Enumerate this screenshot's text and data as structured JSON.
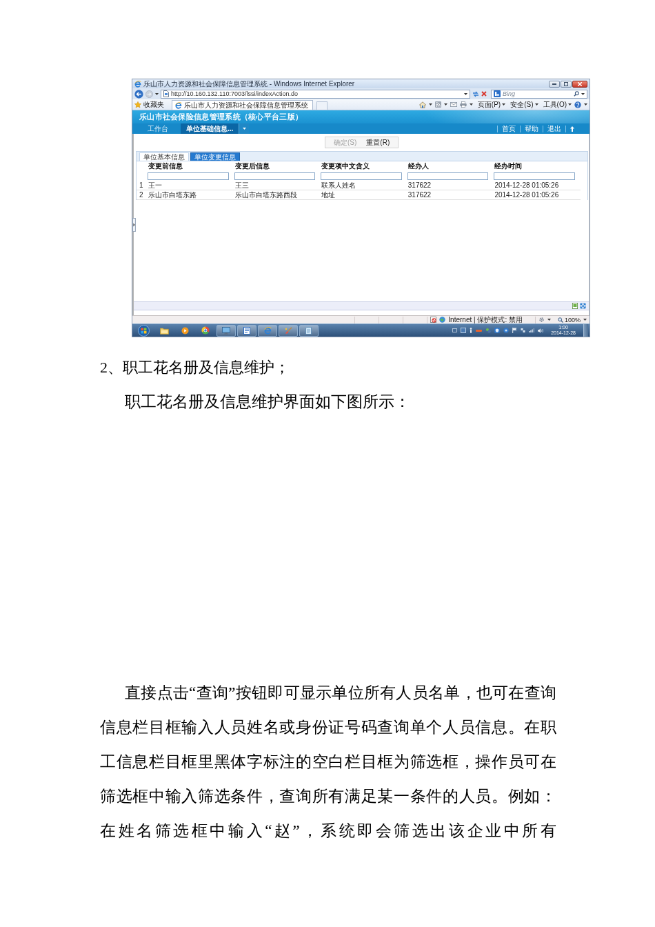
{
  "screenshot": {
    "window": {
      "title": "乐山市人力资源和社会保障信息管理系统 - Windows Internet Explorer"
    },
    "address_bar": {
      "url": "http://10.160.132.110:7003/lssi/indexAction.do"
    },
    "search_field": {
      "placeholder": "Bing"
    },
    "favorites_bar": {
      "favorites": "收藏夹",
      "tab": "乐山市人力资源和社会保障信息管理系统"
    },
    "command_bar": {
      "menus": [
        "页面(P)",
        "安全(S)",
        "工具(O)"
      ]
    },
    "app": {
      "title": "乐山市社会保险信息管理系统（核心平台三版）",
      "nav": [
        {
          "label": "工作台",
          "selected": false
        },
        {
          "label": "单位基础信息...",
          "selected": true
        }
      ],
      "links": [
        "首页",
        "帮助",
        "退出"
      ],
      "actions": [
        {
          "label": "确定(S)",
          "disabled": true
        },
        {
          "label": "重置(R)",
          "disabled": false
        }
      ],
      "tabs": [
        {
          "label": "单位基本信息",
          "selected": false
        },
        {
          "label": "单位变更信息",
          "selected": true
        }
      ],
      "table": {
        "columns": [
          "变更前信息",
          "变更后信息",
          "变更项中文含义",
          "经办人",
          "经办时间"
        ],
        "rows": [
          {
            "index": "1",
            "cells": [
              "王一",
              "王三",
              "联系人姓名",
              "317622",
              "2014-12-28 01:05:26"
            ]
          },
          {
            "index": "2",
            "cells": [
              "乐山市白塔东路",
              "乐山市白塔东路西段",
              "地址",
              "317622",
              "2014-12-28 01:05:26"
            ]
          }
        ]
      }
    },
    "status_bar": {
      "zone": "Internet | 保护模式: 禁用",
      "zoom": "100%"
    },
    "taskbar": {
      "time": "1:00",
      "date": "2014-12-28"
    }
  },
  "heading": "2、职工花名册及信息维护；",
  "caption": "职工花名册及信息维护界面如下图所示：",
  "paragraph": "直接点击“查询”按钮即可显示单位所有人员名单，也可在查询信息栏目框输入人员姓名或身份证号码查询单个人员信息。在职工信息栏目框里黑体字标注的空白栏目框为筛选框，操作员可在筛选框中输入筛选条件，查询所有满足某一条件的人员。例如：在姓名筛选框中输入“赵”，系统即会筛选出该企业中所有"
}
